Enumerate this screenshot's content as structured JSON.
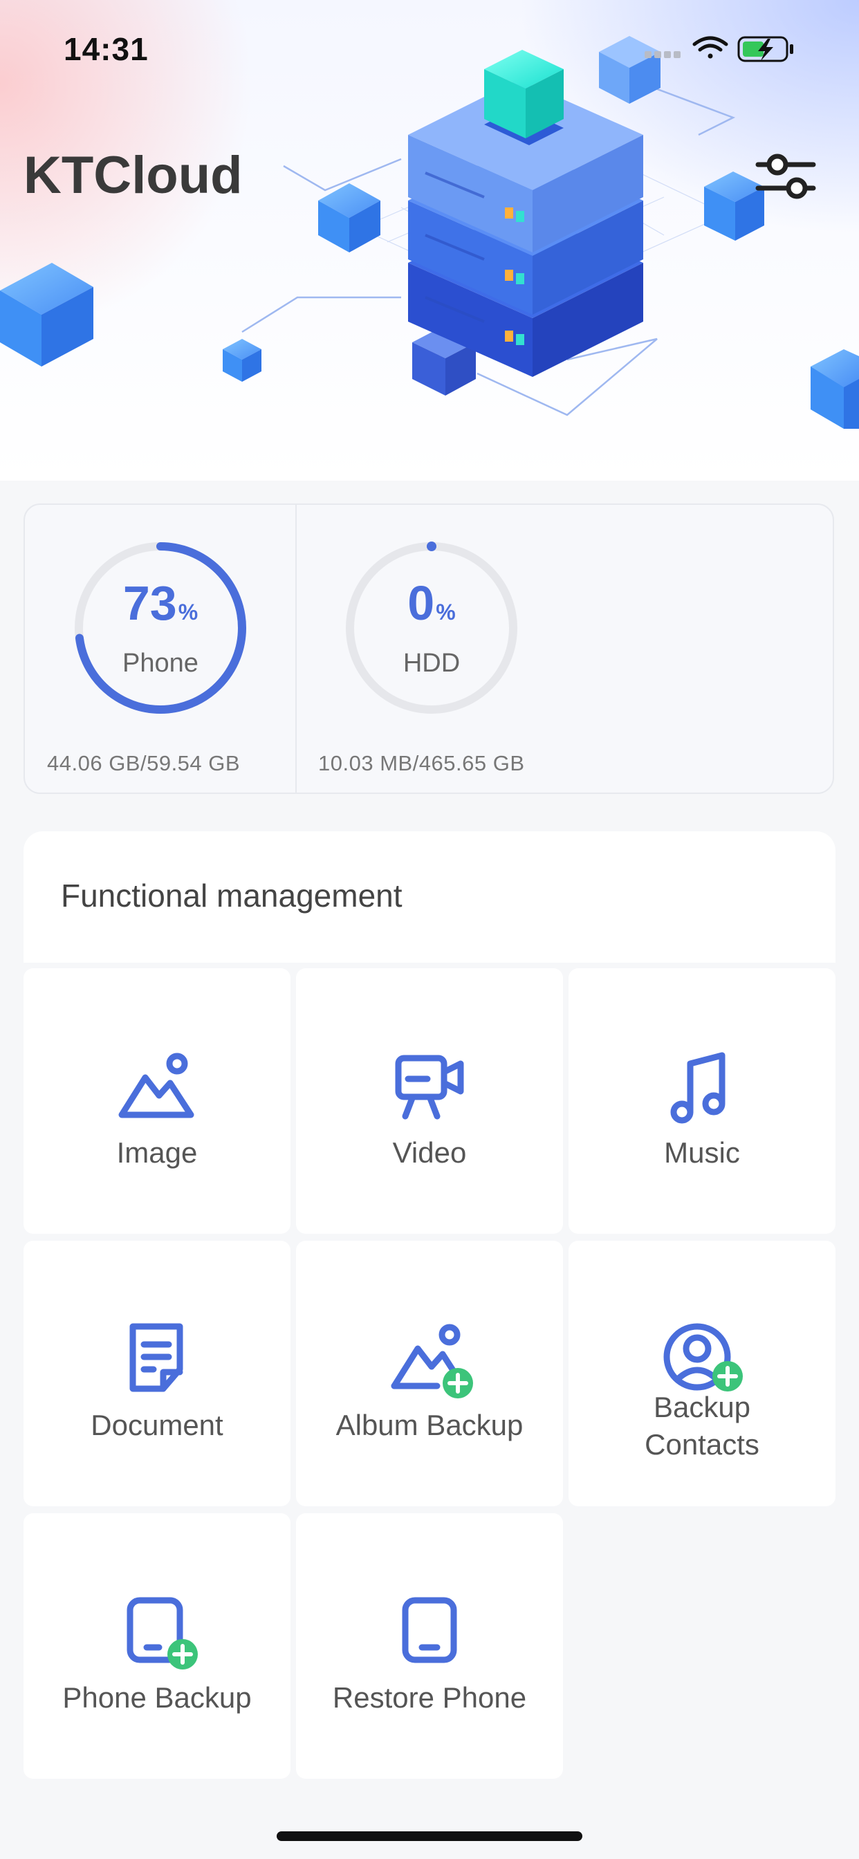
{
  "status_bar": {
    "time": "14:31"
  },
  "app": {
    "title": "KTCloud"
  },
  "storage": [
    {
      "percent": "73",
      "percent_sign": "%",
      "label": "Phone",
      "usage": "44.06 GB/59.54 GB",
      "fill_fraction": 0.73
    },
    {
      "percent": "0",
      "percent_sign": "%",
      "label": "HDD",
      "usage": "10.03 MB/465.65 GB",
      "fill_fraction": 0.0
    }
  ],
  "functional": {
    "title": "Functional management",
    "items": [
      {
        "label": "Image",
        "icon": "image-icon"
      },
      {
        "label": "Video",
        "icon": "video-icon"
      },
      {
        "label": "Music",
        "icon": "music-icon"
      },
      {
        "label": "Document",
        "icon": "document-icon"
      },
      {
        "label": "Album Backup",
        "icon": "album-backup-icon"
      },
      {
        "label": "Backup Contacts",
        "icon": "backup-contacts-icon"
      },
      {
        "label": "Phone Backup",
        "icon": "phone-backup-icon"
      },
      {
        "label": "Restore Phone",
        "icon": "restore-phone-icon"
      }
    ]
  },
  "colors": {
    "accent": "#4a6edb",
    "plus_badge": "#3cc47a",
    "track": "#e6e7eb"
  }
}
